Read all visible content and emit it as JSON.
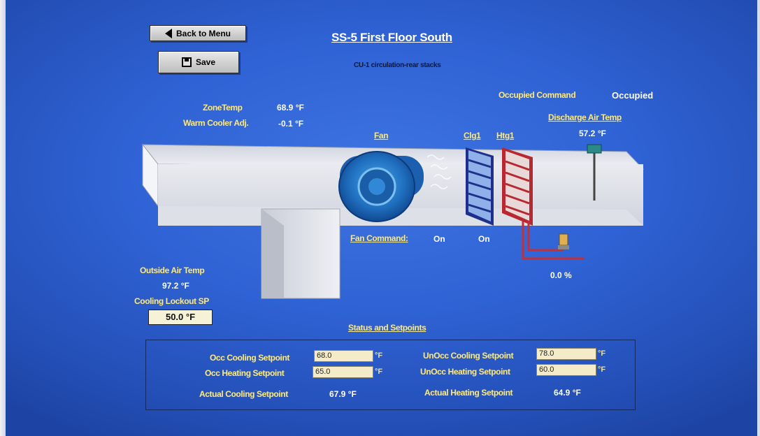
{
  "screen": {
    "title": "SS-5 First Floor South",
    "subtitle": "CU-1 circulation-rear stacks"
  },
  "buttons": {
    "back_label": "Back to Menu",
    "save_label": "Save"
  },
  "zone": {
    "zone_temp_label": "ZoneTemp",
    "zone_temp_value": "68.9 °F",
    "warm_cooler_label": "Warm Cooler Adj.",
    "warm_cooler_value": "-0.1 °F"
  },
  "occupancy": {
    "label": "Occupied Command",
    "value": "Occupied"
  },
  "discharge": {
    "label": "Discharge Air Temp",
    "value": "57.2 °F"
  },
  "equipment": {
    "fan_label": "Fan",
    "clg_label": "Clg1",
    "htg_label": "Htg1"
  },
  "fan_command": {
    "label": "Fan Command:",
    "value1": "On",
    "value2": "On"
  },
  "valve": {
    "value": "0.0 %"
  },
  "outside": {
    "oat_label": "Outside Air Temp",
    "oat_value": "97.2 °F",
    "lockout_label": "Cooling Lockout SP",
    "lockout_value": "50.0 °F"
  },
  "setpoints": {
    "header": "Status and Setpoints",
    "occ_cool_label": "Occ Cooling Setpoint",
    "occ_cool_value": "68.0",
    "occ_heat_label": "Occ Heating Setpoint",
    "occ_heat_value": "65.0",
    "unocc_cool_label": "UnOcc Cooling Setpoint",
    "unocc_cool_value": "78.0",
    "unocc_heat_label": "UnOcc Heating Setpoint",
    "unocc_heat_value": "60.0",
    "actual_cool_label": "Actual Cooling Setpoint",
    "actual_cool_value": "67.9 °F",
    "actual_heat_label": "Actual Heating Setpoint",
    "actual_heat_value": "64.9 °F",
    "unit": "°F"
  },
  "colors": {
    "background": "#2f62d4",
    "label_yellow": "#f2e89a",
    "field_bg": "#f4ecc8",
    "heating_coil": "#b82830",
    "cooling_coil": "#1e2f8c"
  }
}
